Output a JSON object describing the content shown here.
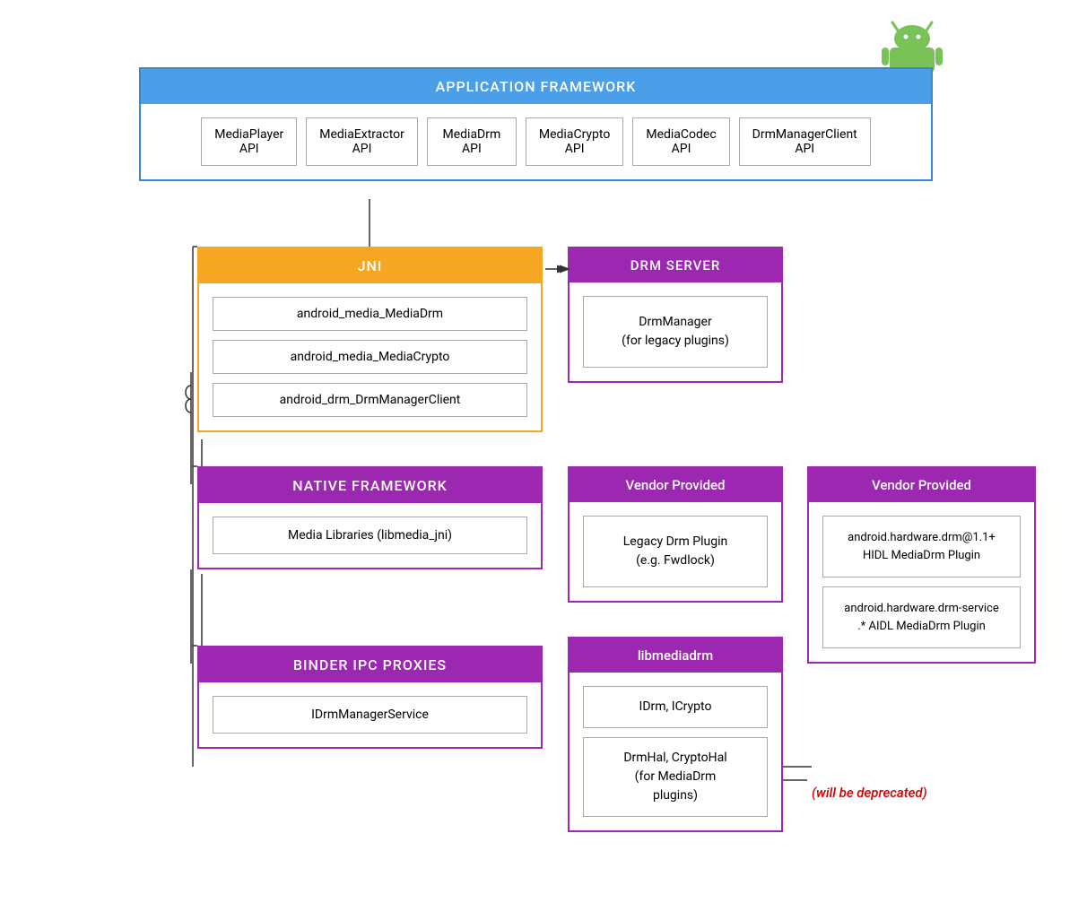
{
  "androidLogo": {
    "color": "#78C257",
    "alt": "Android Logo"
  },
  "appFramework": {
    "title": "APPLICATION FRAMEWORK",
    "apis": [
      {
        "line1": "MediaPlayer",
        "line2": "API"
      },
      {
        "line1": "MediaExtractor",
        "line2": "API"
      },
      {
        "line1": "MediaDrm",
        "line2": "API"
      },
      {
        "line1": "MediaCrypto",
        "line2": "API"
      },
      {
        "line1": "MediaCodec",
        "line2": "API"
      },
      {
        "line1": "DrmManagerClient",
        "line2": "API"
      }
    ]
  },
  "jni": {
    "title": "JNI",
    "items": [
      "android_media_MediaDrm",
      "android_media_MediaCrypto",
      "android_drm_DrmManagerClient"
    ]
  },
  "drmServer": {
    "title": "DRM SERVER",
    "item": "DrmManager\n(for legacy plugins)"
  },
  "nativeFramework": {
    "title": "NATIVE FRAMEWORK",
    "item": "Media Libraries (libmedia_jni)"
  },
  "vendor1": {
    "title": "Vendor Provided",
    "item": "Legacy Drm Plugin\n(e.g. Fwdlock)"
  },
  "vendor2": {
    "title": "Vendor Provided",
    "items": [
      "android.hardware.drm@1.1+\nHIDL MediaDrm Plugin",
      "android.hardware.drm-service\n.* AIDL MediaDrm Plugin"
    ]
  },
  "binder": {
    "title": "BINDER IPC PROXIES",
    "item": "IDrmManagerService"
  },
  "libmediadrm": {
    "title": "libmediadrm",
    "items": [
      "IDrm, ICrypto",
      "DrmHal, CryptoHal\n(for MediaDrm\nplugins)"
    ]
  },
  "deprecated": "(will be deprecated)"
}
